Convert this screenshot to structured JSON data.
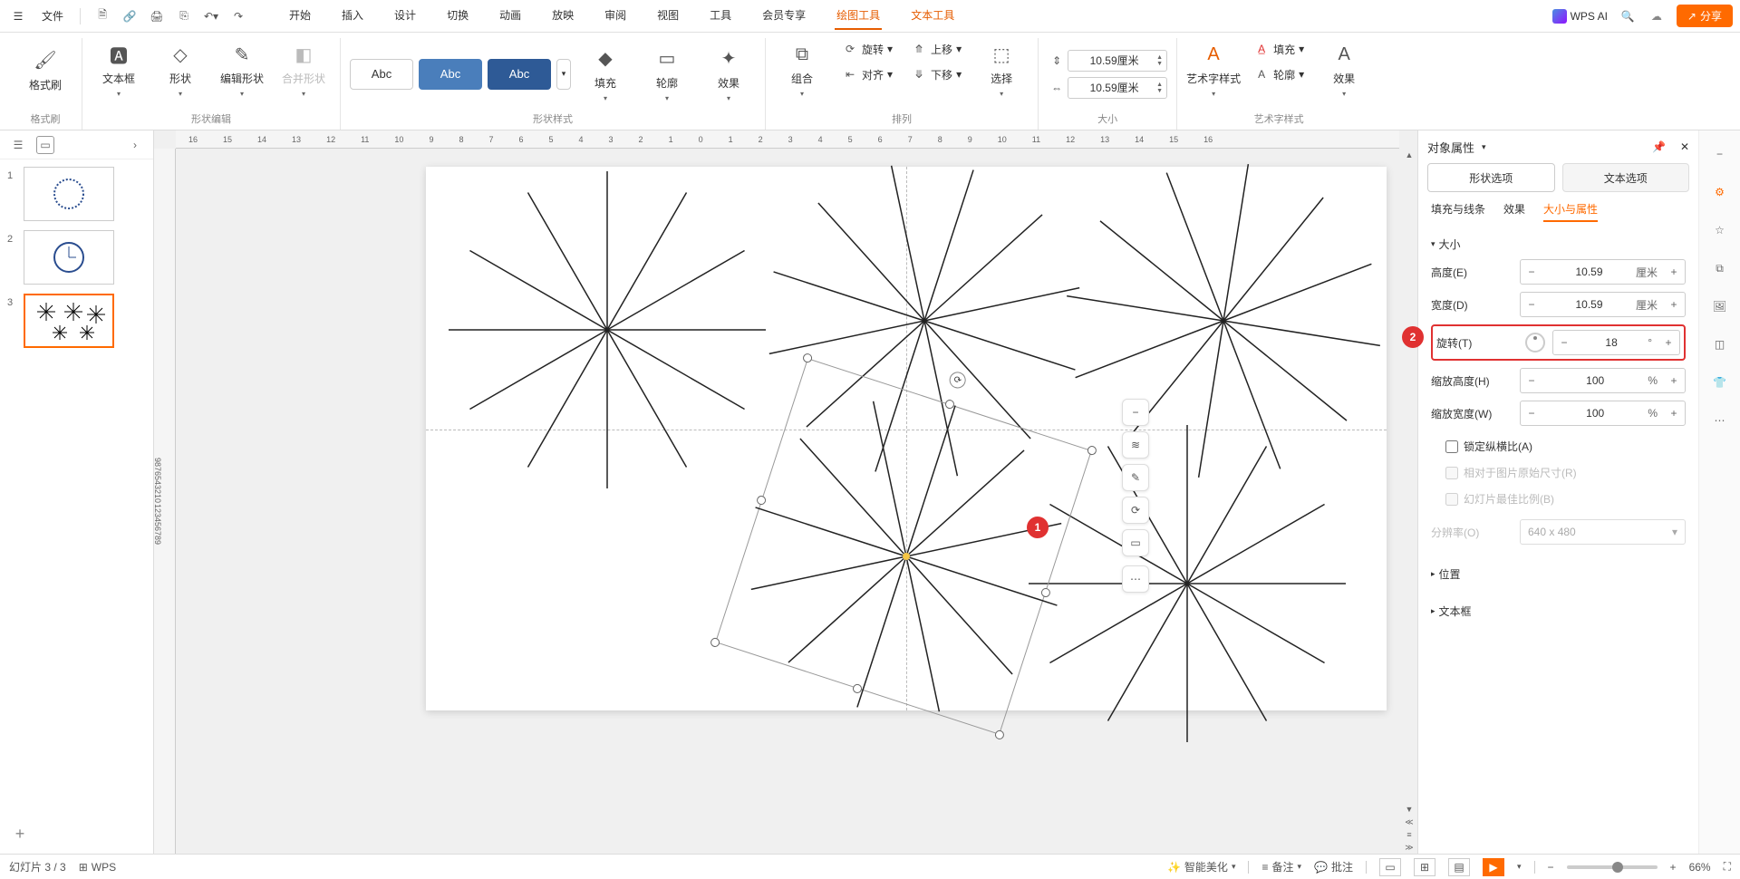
{
  "menubar": {
    "file": "文件",
    "tabs": [
      "开始",
      "插入",
      "设计",
      "切换",
      "动画",
      "放映",
      "审阅",
      "视图",
      "工具",
      "会员专享",
      "绘图工具",
      "文本工具"
    ],
    "active_tabs": [
      "绘图工具",
      "文本工具"
    ],
    "wps_ai": "WPS AI",
    "share": "分享"
  },
  "ribbon": {
    "group1_label": "格式刷",
    "format_painter": "格式刷",
    "group2_label": "形状编辑",
    "textbox": "文本框",
    "shape": "形状",
    "edit_shape": "编辑形状",
    "merge_shape": "合并形状",
    "group3_label": "形状样式",
    "abc": "Abc",
    "fill": "填充",
    "outline": "轮廓",
    "effect": "效果",
    "group4_label": "排列",
    "group": "组合",
    "rotate": "旋转",
    "align": "对齐",
    "move_up": "上移",
    "move_down": "下移",
    "select": "选择",
    "group5_label": "大小",
    "height_val": "10.59厘米",
    "width_val": "10.59厘米",
    "group6_label": "艺术字样式",
    "art_style": "艺术字样式",
    "art_fill": "填充",
    "art_outline": "轮廓",
    "art_effect": "效果"
  },
  "thumbs": {
    "count": 3,
    "active": 3
  },
  "badges": {
    "b1": "1",
    "b2": "2"
  },
  "props": {
    "title": "对象属性",
    "tab_shape": "形状选项",
    "tab_text": "文本选项",
    "sub_fill": "填充与线条",
    "sub_effect": "效果",
    "sub_size": "大小与属性",
    "sec_size": "大小",
    "height_label": "高度(E)",
    "height_val": "10.59",
    "height_unit": "厘米",
    "width_label": "宽度(D)",
    "width_val": "10.59",
    "width_unit": "厘米",
    "rotate_label": "旋转(T)",
    "rotate_val": "18",
    "rotate_unit": "°",
    "scale_h_label": "缩放高度(H)",
    "scale_h_val": "100",
    "scale_w_label": "缩放宽度(W)",
    "scale_w_val": "100",
    "percent": "%",
    "lock_ratio": "锁定纵横比(A)",
    "rel_orig": "相对于图片原始尺寸(R)",
    "best_ratio": "幻灯片最佳比例(B)",
    "resolution_label": "分辨率(O)",
    "resolution_val": "640 x 480",
    "sec_position": "位置",
    "sec_textbox": "文本框"
  },
  "statusbar": {
    "slide_info": "幻灯片 3 / 3",
    "wps": "WPS",
    "beautify": "智能美化",
    "notes": "备注",
    "comments": "批注",
    "zoom": "66%"
  },
  "ruler_h": [
    "16",
    "15",
    "14",
    "13",
    "12",
    "11",
    "10",
    "9",
    "8",
    "7",
    "6",
    "5",
    "4",
    "3",
    "2",
    "1",
    "0",
    "1",
    "2",
    "3",
    "4",
    "5",
    "6",
    "7",
    "8",
    "9",
    "10",
    "11",
    "12",
    "13",
    "14",
    "15",
    "16"
  ],
  "ruler_v": [
    "9",
    "8",
    "7",
    "6",
    "5",
    "4",
    "3",
    "2",
    "1",
    "0",
    "1",
    "2",
    "3",
    "4",
    "5",
    "6",
    "7",
    "8",
    "9"
  ]
}
